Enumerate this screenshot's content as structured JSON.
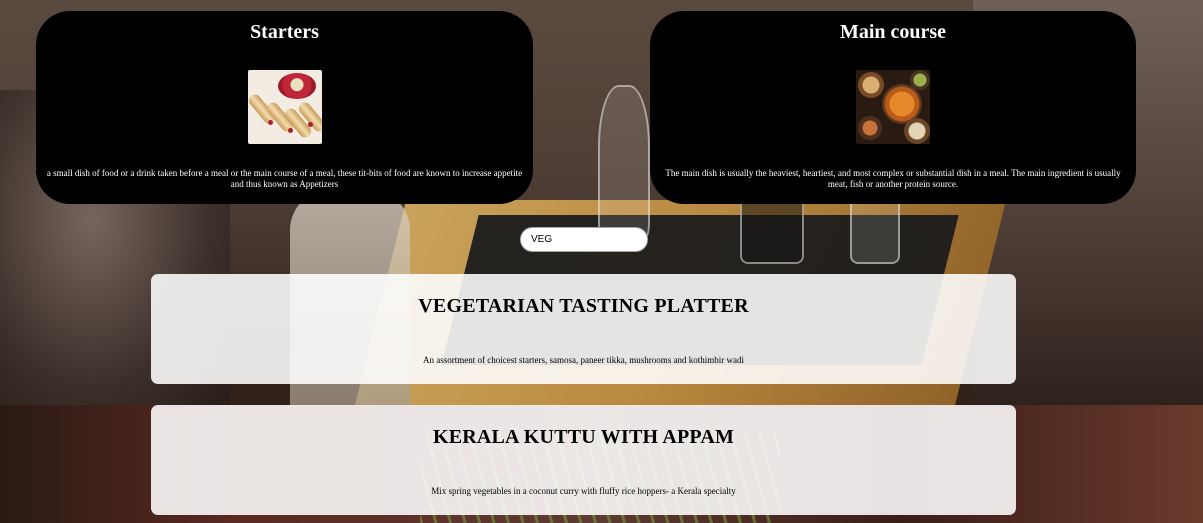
{
  "categories": [
    {
      "title": "Starters",
      "image_icon": "spring-rolls-platter-image",
      "description": "a small dish of food or a drink taken before a meal or the main course of a meal, these tit-bits of food are known to increase appetite and thus known as Appetizers"
    },
    {
      "title": "Main course",
      "image_icon": "curry-dishes-image",
      "description": "The main dish is usually the heaviest, heartiest, and most complex or substantial dish in a meal. The main ingredient is usually meat, fish or another protein source."
    }
  ],
  "search": {
    "value": "VEG"
  },
  "results": [
    {
      "name": "VEGETARIAN TASTING PLATTER",
      "description": "An assortment of choicest starters, samosa, paneer tikka, mushrooms and kothimbir wadi"
    },
    {
      "name": "KERALA KUTTU WITH APPAM",
      "description": "Mix spring vegetables in a coconut curry with fluffy rice hoppers- a Kerala specialty"
    }
  ],
  "colors": {
    "card_bg": "#000000",
    "card_text": "#ffffff",
    "result_bg": "rgba(255,255,255,0.88)"
  }
}
